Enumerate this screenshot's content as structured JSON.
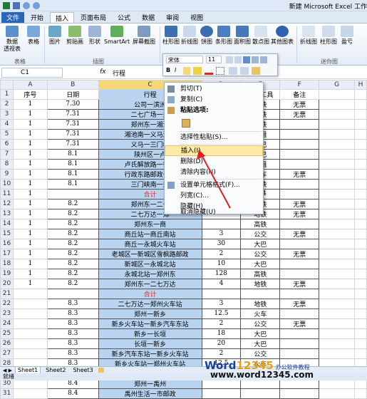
{
  "window_title": "新建 Microsoft Excel 工作",
  "tabs": [
    "文件",
    "开始",
    "插入",
    "页面布局",
    "公式",
    "数据",
    "审阅",
    "视图"
  ],
  "ribbon": {
    "items": [
      "数据\n透视表",
      "表格",
      "图片",
      "剪贴画",
      "形状",
      "SmartArt",
      "屏幕截图",
      "柱形图",
      "折线图",
      "饼图",
      "条形图",
      "面积图",
      "散点图",
      "其他图表",
      "折线图",
      "柱形图",
      "盈亏"
    ],
    "groups": [
      "表格",
      "插图",
      "迷你图"
    ]
  },
  "namebox": "C1",
  "fx": "fx",
  "formula": "行程",
  "columns": [
    "A",
    "B",
    "C",
    "D",
    "E",
    "F",
    "G",
    "H"
  ],
  "rows": [
    [
      "序号",
      "日期",
      "行程",
      "",
      "交通工具",
      "备注"
    ],
    [
      "1",
      "7.30",
      "公司一滨洲",
      "",
      "地铁",
      "无票"
    ],
    [
      "1",
      "7.31",
      "二七广场一郑",
      "",
      "地铁",
      "无票"
    ],
    [
      "1",
      "7.31",
      "郑州东一湘池",
      "",
      "高铁",
      ""
    ],
    [
      "1",
      "7.31",
      "湘池南一义马湘庆",
      "",
      "出租",
      ""
    ],
    [
      "1",
      "7.31",
      "义马一三门峡",
      "",
      "大巴",
      ""
    ],
    [
      "1",
      "8.1",
      "陕州区一卢",
      "",
      "大巴",
      ""
    ],
    [
      "1",
      "8.1",
      "卢氏解放路一行政",
      "",
      "出租",
      ""
    ],
    [
      "1",
      "8.1",
      "行政东路邮政一三",
      "",
      "拼车",
      "无票"
    ],
    [
      "1",
      "8.1",
      "三门峡南一郑",
      "",
      "高铁",
      ""
    ],
    [
      "1",
      "",
      "合计",
      "",
      "374",
      ""
    ],
    [
      "1",
      "8.2",
      "郑州东一二七",
      "",
      "地铁",
      "无票"
    ],
    [
      "1",
      "8.2",
      "二七万达一郑",
      "",
      "地铁",
      "无票"
    ],
    [
      "1",
      "8.2",
      "郑州东一商",
      "",
      "高铁",
      ""
    ],
    [
      "1",
      "8.2",
      "商丘站一商丘南站",
      "3",
      "公交",
      "无票"
    ],
    [
      "1",
      "8.2",
      "商丘一永城火车站",
      "30",
      "大巴",
      ""
    ],
    [
      "1",
      "8.2",
      "老城区一新城区雪枫路邮政",
      "2",
      "公交",
      "无票"
    ],
    [
      "1",
      "8.2",
      "新城区一永城北站",
      "10",
      "大巴",
      ""
    ],
    [
      "1",
      "8.2",
      "永城北站一郑州东",
      "128",
      "高铁",
      ""
    ],
    [
      "1",
      "8.2",
      "郑州东一二七万达",
      "4",
      "地铁",
      "无票"
    ],
    [
      "",
      "",
      "合计",
      "",
      "",
      ""
    ],
    [
      "",
      "8.3",
      "二七万达一郑州火车站",
      "3",
      "地铁",
      "无票"
    ],
    [
      "",
      "8.3",
      "郑州一新乡",
      "12.5",
      "火车",
      ""
    ],
    [
      "",
      "8.3",
      "新乡火车站一新乡汽车东站",
      "2",
      "公交",
      "无票"
    ],
    [
      "",
      "8.3",
      "新乡一长垣",
      "18",
      "大巴",
      ""
    ],
    [
      "",
      "8.3",
      "长垣一新乡",
      "20",
      "大巴",
      ""
    ],
    [
      "",
      "8.3",
      "新乡汽车东站一新乡火车站",
      "2",
      "公交",
      ""
    ],
    [
      "",
      "8.3",
      "新乡火车站一郑州火车站",
      "12.5",
      "火车",
      ""
    ],
    [
      "",
      "8.3",
      "郑州火车站一二七万达",
      "3",
      "地铁",
      ""
    ],
    [
      "",
      "8.4",
      "郑州一禹州",
      "",
      "",
      " "
    ],
    [
      "",
      "8.4",
      "禹州生活一市邮政",
      "",
      "",
      " "
    ]
  ],
  "row_numbers": [
    "1",
    "2",
    "3",
    "4",
    "5",
    "6",
    "7",
    "8",
    "9",
    "10",
    "11",
    "12",
    "13",
    "14",
    "15",
    "16",
    "17",
    "18",
    "19",
    "20",
    "21",
    "22",
    "23",
    "24",
    "25",
    "26",
    "27",
    "28",
    "29",
    "30",
    "31"
  ],
  "context_menu": [
    "剪切(T)",
    "复制(C)",
    "粘贴选项:",
    "",
    "选择性粘贴(S)...",
    "插入(I)",
    "删除(D)",
    "清除内容(N)",
    "设置单元格格式(F)...",
    "列宽(C)...",
    "隐藏(H)",
    "取消隐藏(U)"
  ],
  "mini_toolbar": {
    "font": "宋体",
    "size": "11"
  },
  "sheet_tabs": [
    "Sheet1",
    "Sheet2",
    "Sheet3"
  ],
  "status": "就绪",
  "watermark": {
    "brand_a": "Word",
    "brand_b": "12345",
    "brand_c": "办公软件教程",
    "url": "www.word12345.com"
  },
  "colors": {
    "accent": "#2a66b8",
    "selection": "#b8d4f0",
    "highlight": "#fde9a8",
    "arrow": "#e02020",
    "heji": "#d9302c"
  }
}
